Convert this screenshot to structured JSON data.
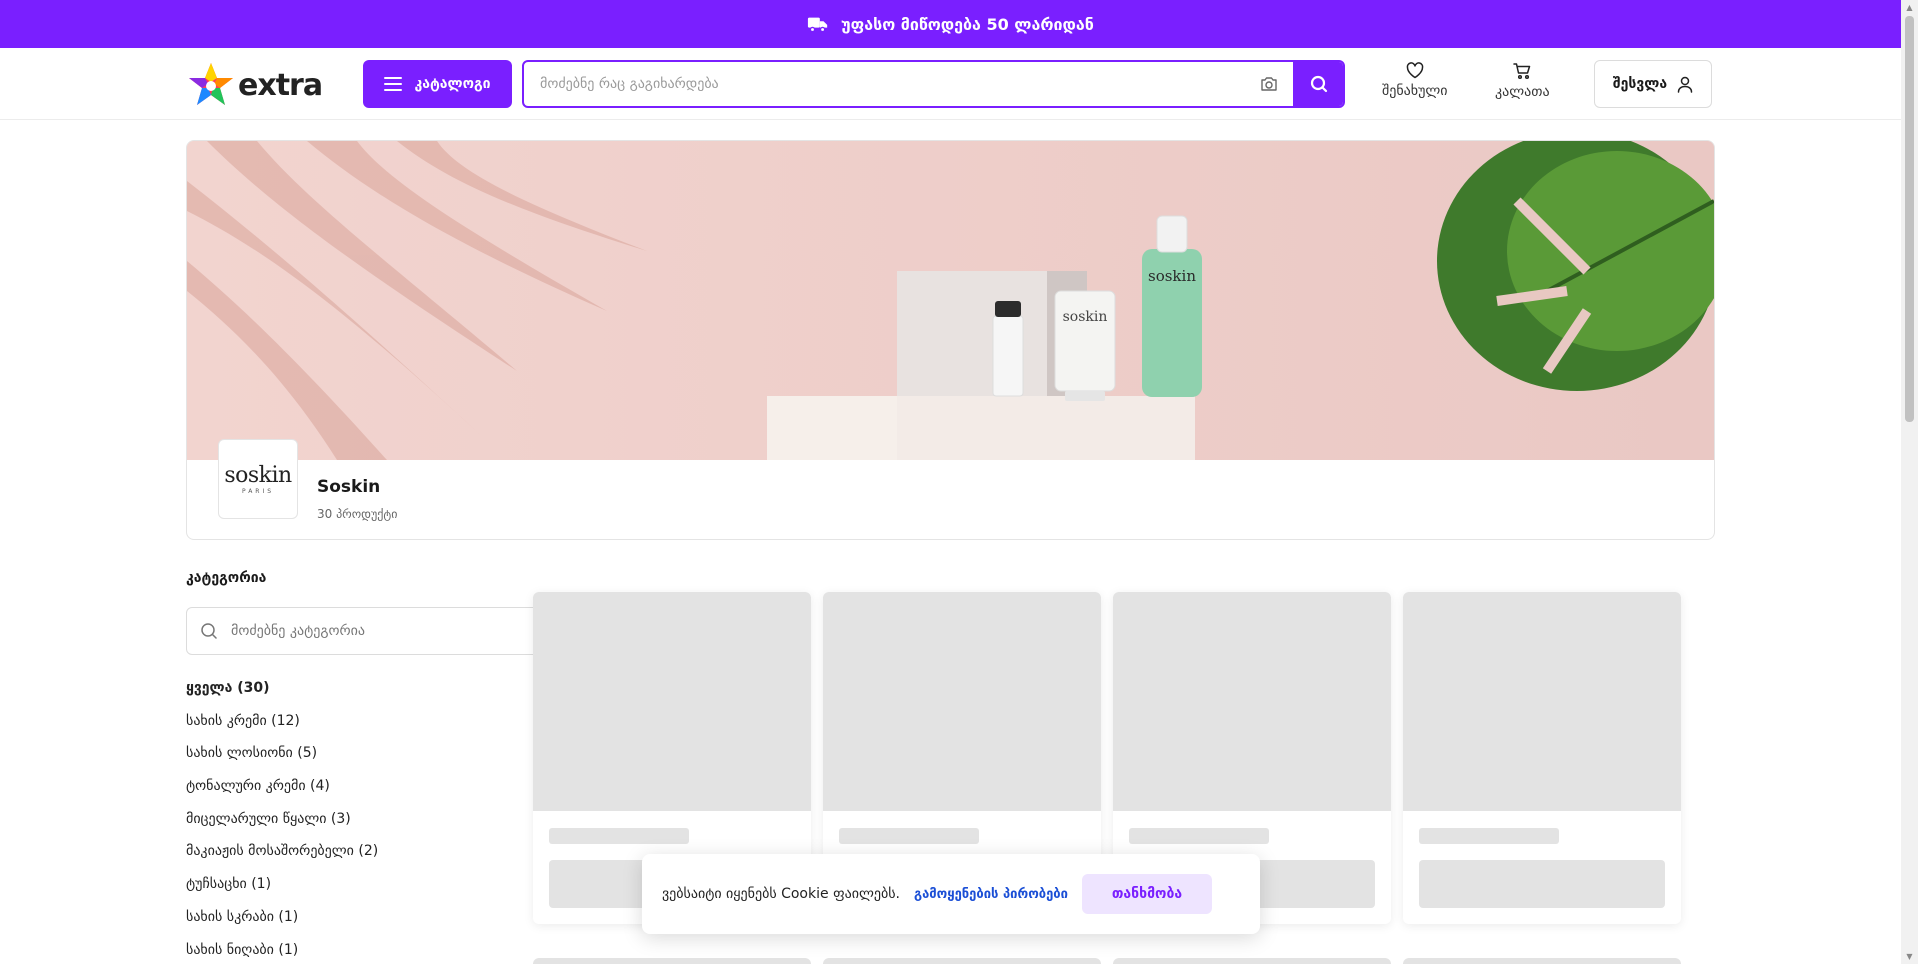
{
  "promo": {
    "text": "უფასო მიწოდება 50 ლარიდან",
    "icon": "delivery-truck-icon"
  },
  "header": {
    "logo_text": "extra",
    "catalog_label": "კატალოგი",
    "search_placeholder": "მოძებნე რაც გაგიხარდება",
    "favorites_label": "შენახული",
    "cart_label": "კალათა",
    "login_label": "შესვლა"
  },
  "brand": {
    "name": "Soskin",
    "product_count": "30 პროდუქტი",
    "logo_text": "soskin",
    "logo_sub": "PARIS"
  },
  "sidebar": {
    "title": "კატეგორია",
    "search_placeholder": "მოძებნე კატეგორია",
    "categories": [
      "ყველა (30)",
      "სახის კრემი (12)",
      "სახის ლოსიონი (5)",
      "ტონალური კრემი (4)",
      "მიცელარული წყალი (3)",
      "მაკიაჟის მოსაშორებელი (2)",
      "ტუჩსაცხი (1)",
      "სახის სკრაბი (1)",
      "სახის ნიღაბი (1)"
    ]
  },
  "cookie": {
    "text": "ვებსაიტი იყენებს Cookie ფაილებს.",
    "link": "გამოყენების პირობები",
    "agree": "თანხმობა"
  },
  "colors": {
    "brand": "#7a1fff",
    "link": "#1b4fd6",
    "skeleton": "#e3e3e3"
  }
}
